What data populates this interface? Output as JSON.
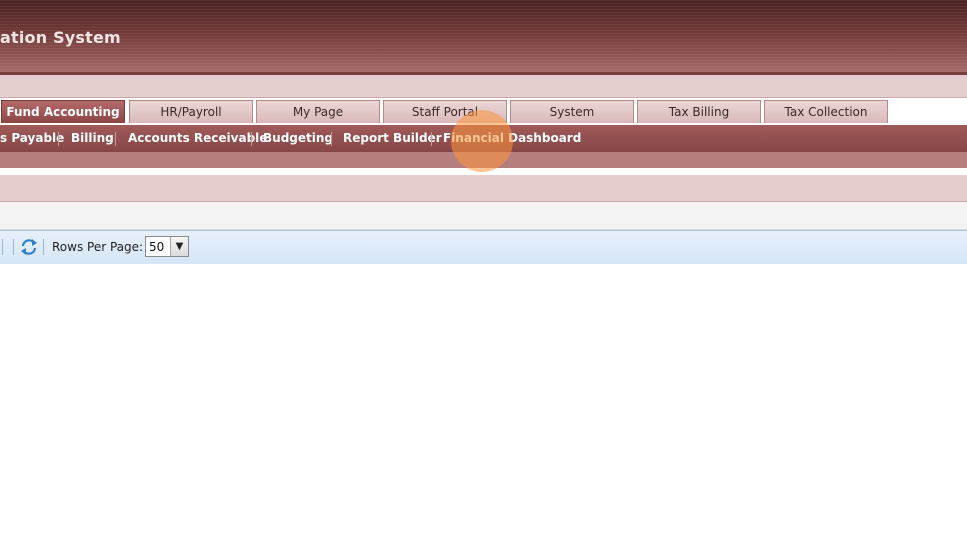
{
  "header": {
    "app_title": "ation System"
  },
  "tabs": [
    {
      "label": "Fund Accounting",
      "active": true
    },
    {
      "label": "HR/Payroll",
      "active": false
    },
    {
      "label": "My Page",
      "active": false
    },
    {
      "label": "Staff Portal",
      "active": false
    },
    {
      "label": "System",
      "active": false
    },
    {
      "label": "Tax Billing",
      "active": false
    },
    {
      "label": "Tax Collection",
      "active": false
    }
  ],
  "menu": {
    "items": [
      {
        "label": "s Payable"
      },
      {
        "label": "Billing"
      },
      {
        "label": "Accounts Receivable"
      },
      {
        "label": "Budgeting"
      },
      {
        "label": "Report Builder"
      },
      {
        "label": "Financial Dashboard"
      }
    ]
  },
  "toolbar": {
    "rows_per_page_label": "Rows Per Page:",
    "rows_per_page_value": "50",
    "refresh_icon": "refresh-icon"
  },
  "colors": {
    "header_dark": "#4a2222",
    "active_tab": "#8c4545",
    "menubar": "#a05a5a",
    "toolbar": "#d6e6f7",
    "cursor_highlight": "#ff963c"
  }
}
